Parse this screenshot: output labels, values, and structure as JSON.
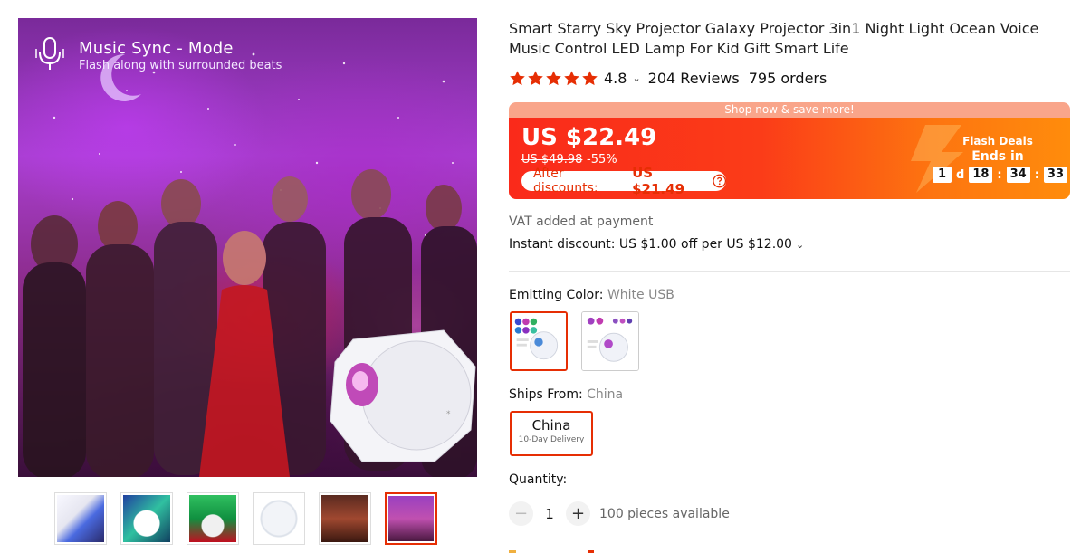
{
  "gallery": {
    "overlay_title": "Music Sync - Mode",
    "overlay_subtitle": "Flash along with surrounded beats",
    "thumbnails": [
      {
        "name": "thumb-1"
      },
      {
        "name": "thumb-2"
      },
      {
        "name": "thumb-3"
      },
      {
        "name": "thumb-4"
      },
      {
        "name": "thumb-5"
      },
      {
        "name": "thumb-6",
        "active": true
      }
    ]
  },
  "product": {
    "title": "Smart Starry Sky Projector Galaxy Projector 3in1 Night Light Ocean Voice Music Control LED Lamp For Kid Gift Smart Life",
    "rating": "4.8",
    "rating_stars": 5,
    "reviews": "204 Reviews",
    "orders": "795 orders"
  },
  "price": {
    "banner": "Shop now & save more!",
    "current": "US $22.49",
    "original": "US $49.98",
    "discount_pct": "-55%",
    "after_label": "After discounts:",
    "after_value": "US $21.49",
    "flash_title": "Flash Deals",
    "ends_in": "Ends in",
    "timer": {
      "days": "1",
      "d": "d",
      "hours": "18",
      "minutes": "34",
      "seconds": "33"
    },
    "colors": {
      "accent": "#e62e04",
      "gradient_start": "#fa2a1a",
      "gradient_end": "#ff8c0c"
    }
  },
  "vat_note": "VAT added at payment",
  "instant_discount": "Instant discount: US $1.00 off per US $12.00",
  "emitting_color": {
    "label": "Emitting Color:",
    "value": "White USB",
    "options": [
      {
        "name": "White USB",
        "selected": true
      },
      {
        "name": "option-2",
        "selected": false
      }
    ]
  },
  "ships_from": {
    "label": "Ships From:",
    "value": "China",
    "option_name": "China",
    "option_sub": "10-Day Delivery"
  },
  "quantity": {
    "label": "Quantity:",
    "value": "1",
    "available": "100 pieces available",
    "minus": "−",
    "plus": "+"
  }
}
